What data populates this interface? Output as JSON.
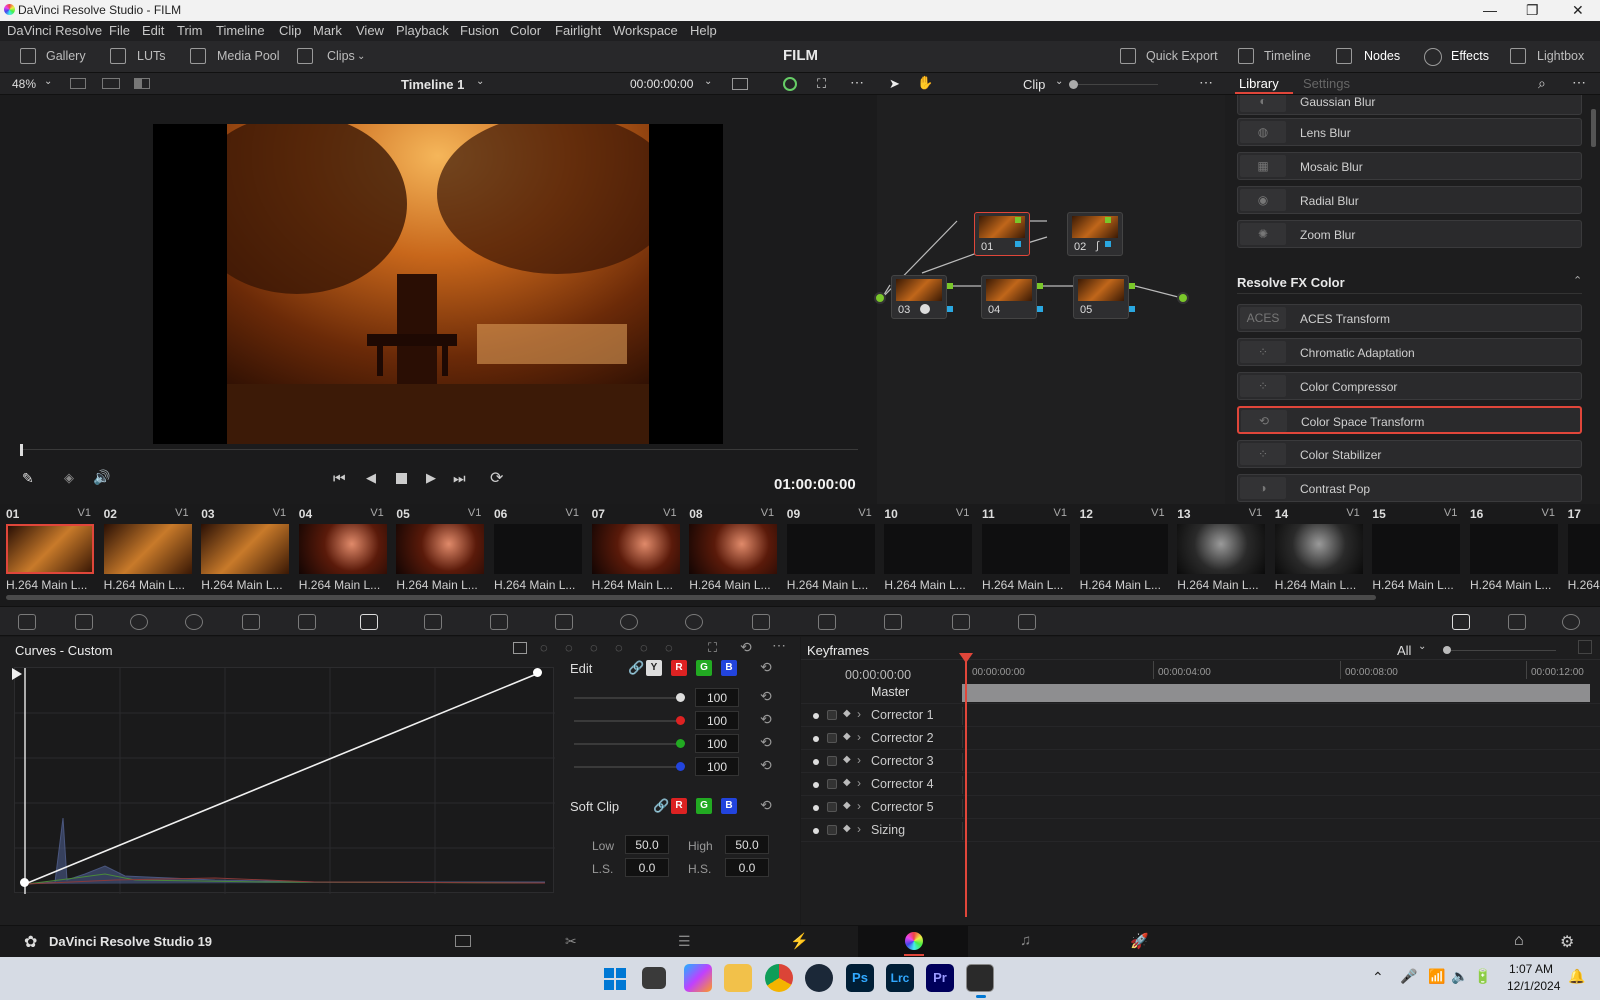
{
  "window": {
    "title": "DaVinci Resolve Studio - FILM",
    "minimize": "—",
    "maximize": "❐",
    "close": "✕"
  },
  "menu": [
    "DaVinci Resolve",
    "File",
    "Edit",
    "Trim",
    "Timeline",
    "Clip",
    "Mark",
    "View",
    "Playback",
    "Fusion",
    "Color",
    "Fairlight",
    "Workspace",
    "Help"
  ],
  "toolbar": {
    "gallery": "Gallery",
    "luts": "LUTs",
    "media_pool": "Media Pool",
    "clips": "Clips",
    "project": "FILM",
    "quick_export": "Quick Export",
    "timeline": "Timeline",
    "nodes": "Nodes",
    "effects": "Effects",
    "lightbox": "Lightbox"
  },
  "viewer": {
    "zoom": "48%",
    "timeline_name": "Timeline 1",
    "timecode": "00:00:00:00",
    "playhead_tc": "01:00:00:00"
  },
  "nodebar": {
    "mode": "Clip"
  },
  "nodes": [
    {
      "label": "01"
    },
    {
      "label": "02"
    },
    {
      "label": "03"
    },
    {
      "label": "04"
    },
    {
      "label": "05"
    }
  ],
  "library": {
    "tab_library": "Library",
    "tab_settings": "Settings",
    "items_top": [
      "Gaussian Blur",
      "Lens Blur",
      "Mosaic Blur",
      "Radial Blur",
      "Zoom Blur"
    ],
    "section": "Resolve FX Color",
    "items_color": [
      "ACES Transform",
      "Chromatic Adaptation",
      "Color Compressor",
      "Color Space Transform",
      "Color Stabilizer",
      "Contrast Pop"
    ],
    "aces_icon_text": "ACES"
  },
  "clips": [
    {
      "num": "01",
      "track": "V1",
      "name": "H.264 Main L..."
    },
    {
      "num": "02",
      "track": "V1",
      "name": "H.264 Main L..."
    },
    {
      "num": "03",
      "track": "V1",
      "name": "H.264 Main L..."
    },
    {
      "num": "04",
      "track": "V1",
      "name": "H.264 Main L..."
    },
    {
      "num": "05",
      "track": "V1",
      "name": "H.264 Main L..."
    },
    {
      "num": "06",
      "track": "V1",
      "name": "H.264 Main L..."
    },
    {
      "num": "07",
      "track": "V1",
      "name": "H.264 Main L..."
    },
    {
      "num": "08",
      "track": "V1",
      "name": "H.264 Main L..."
    },
    {
      "num": "09",
      "track": "V1",
      "name": "H.264 Main L..."
    },
    {
      "num": "10",
      "track": "V1",
      "name": "H.264 Main L..."
    },
    {
      "num": "11",
      "track": "V1",
      "name": "H.264 Main L..."
    },
    {
      "num": "12",
      "track": "V1",
      "name": "H.264 Main L..."
    },
    {
      "num": "13",
      "track": "V1",
      "name": "H.264 Main L..."
    },
    {
      "num": "14",
      "track": "V1",
      "name": "H.264 Main L..."
    },
    {
      "num": "15",
      "track": "V1",
      "name": "H.264 Main L..."
    },
    {
      "num": "16",
      "track": "V1",
      "name": "H.264 Main L..."
    },
    {
      "num": "17",
      "track": "",
      "name": "H.264"
    }
  ],
  "curves": {
    "title": "Curves - Custom",
    "edit_label": "Edit",
    "y": "Y",
    "r": "R",
    "g": "G",
    "b": "B",
    "intensities": [
      "100",
      "100",
      "100",
      "100"
    ],
    "soft_clip": "Soft Clip",
    "low_label": "Low",
    "low": "50.0",
    "high_label": "High",
    "high": "50.0",
    "ls_label": "L.S.",
    "ls": "0.0",
    "hs_label": "H.S.",
    "hs": "0.0"
  },
  "keyframes": {
    "title": "Keyframes",
    "filter": "All",
    "current_tc": "00:00:00:00",
    "ruler": [
      "00:00:00:00",
      "00:00:04:00",
      "00:00:08:00",
      "00:00:12:00"
    ],
    "master": "Master",
    "tracks": [
      "Corrector 1",
      "Corrector 2",
      "Corrector 3",
      "Corrector 4",
      "Corrector 5",
      "Sizing"
    ]
  },
  "pagebar": {
    "app_name": "DaVinci Resolve Studio 19"
  },
  "taskbar": {
    "time": "1:07 AM",
    "date": "12/1/2024",
    "apps": [
      "Ps",
      "Lrc",
      "Pr"
    ]
  },
  "colors": {
    "accent_red": "#e0463a",
    "node_green": "#7ac72a",
    "node_blue": "#2aa7e0"
  }
}
